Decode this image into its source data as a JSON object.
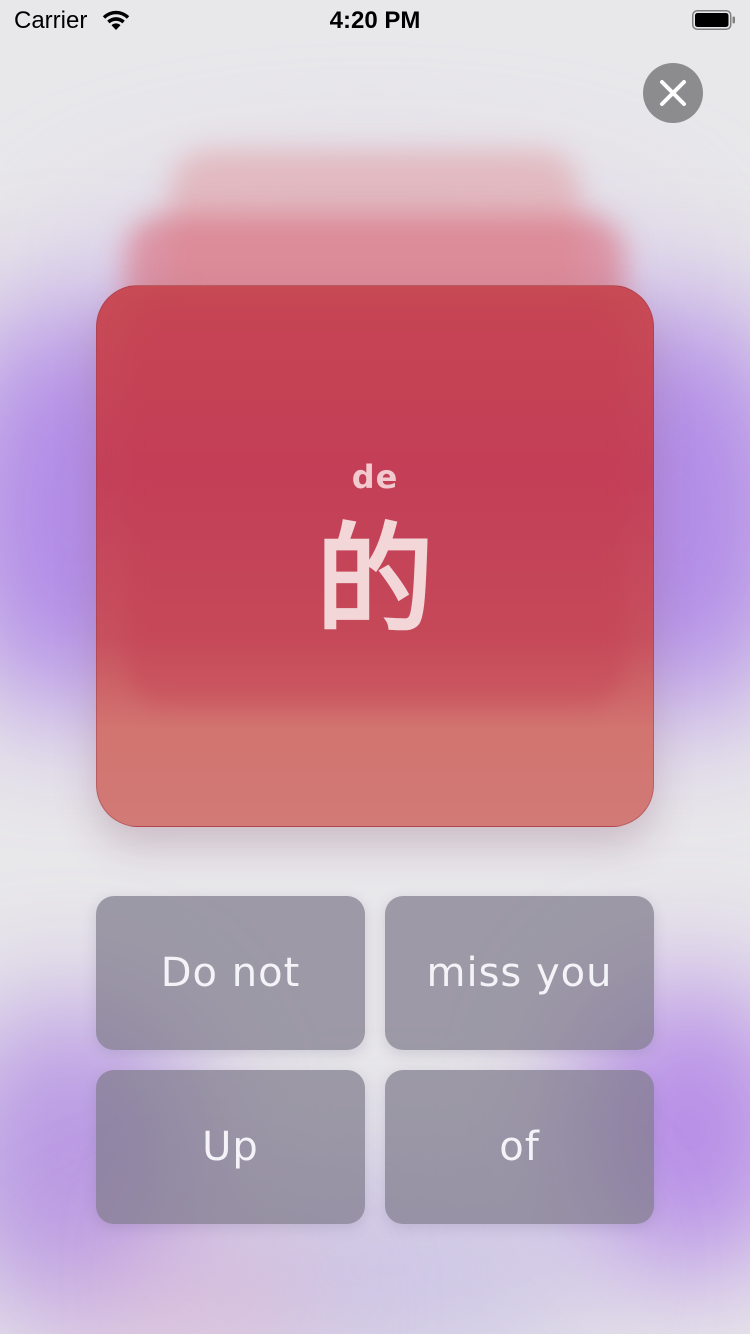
{
  "status_bar": {
    "carrier": "Carrier",
    "time": "4:20 PM",
    "wifi_icon": "wifi-icon",
    "battery_icon": "battery-icon"
  },
  "close_icon": "close-icon",
  "card": {
    "pinyin": "de",
    "hanzi": "的",
    "color": "#c84b55"
  },
  "answers": [
    {
      "label": "Do not"
    },
    {
      "label": "miss you"
    },
    {
      "label": "Up"
    },
    {
      "label": "of"
    }
  ],
  "colors": {
    "card": "#c84b55",
    "answer_button": "#807c8c",
    "background_glow": "#a06ee6",
    "close_button": "#8c8c8e"
  }
}
